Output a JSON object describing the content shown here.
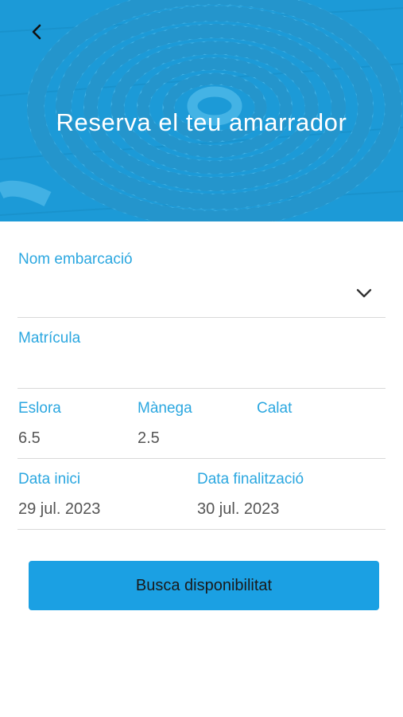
{
  "header": {
    "title": "Reserva el teu amarrador",
    "back_icon": "chevron-left-icon"
  },
  "form": {
    "boat_name": {
      "label": "Nom embarcació",
      "value": "",
      "icon": "chevron-down-icon"
    },
    "registration": {
      "label": "Matrícula",
      "value": ""
    },
    "length": {
      "label": "Eslora",
      "value": "6.5"
    },
    "beam": {
      "label": "Mànega",
      "value": "2.5"
    },
    "draft": {
      "label": "Calat",
      "value": ""
    },
    "start_date": {
      "label": "Data inici",
      "value": "29 jul. 2023"
    },
    "end_date": {
      "label": "Data finalització",
      "value": "30 jul. 2023"
    }
  },
  "actions": {
    "search_label": "Busca disponibilitat"
  },
  "colors": {
    "accent": "#2ba7e0",
    "hero": "#1d9bd8",
    "button": "#1ba0e3",
    "divider": "#d9d9d9"
  }
}
